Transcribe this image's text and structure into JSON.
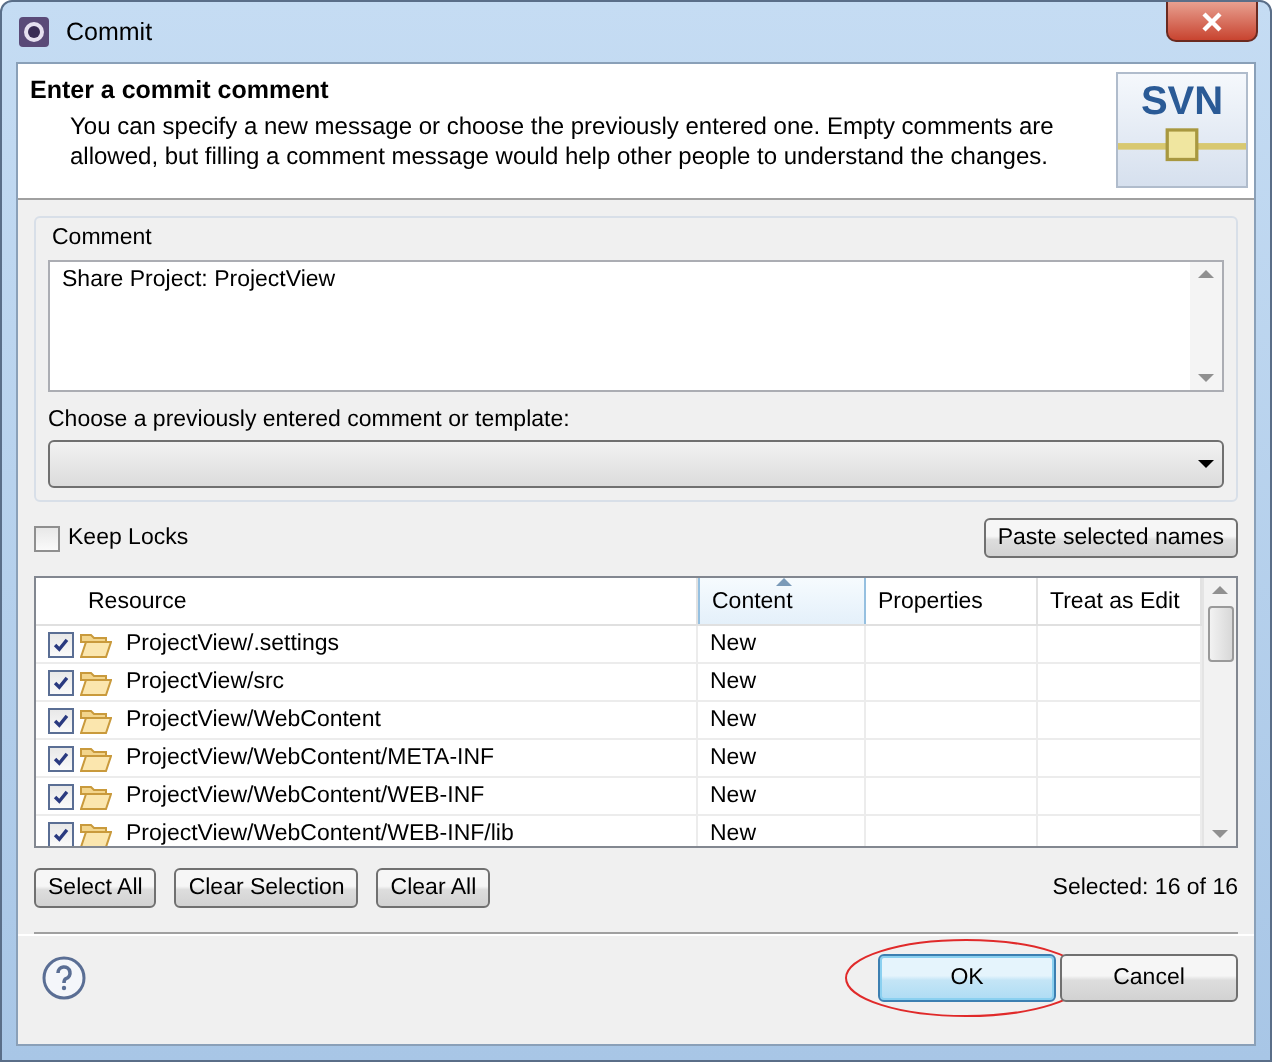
{
  "window": {
    "title": "Commit"
  },
  "header": {
    "title": "Enter a commit comment",
    "description": "You can specify a new message or choose the previously entered one. Empty comments are allowed, but filling a comment message would help other people to understand the changes.",
    "logo": "SVN"
  },
  "comment": {
    "label": "Comment",
    "value": "Share Project: ProjectView",
    "history_label": "Choose a previously entered comment or template:"
  },
  "keep_locks": {
    "label": "Keep Locks",
    "checked": false
  },
  "paste_button": "Paste selected names",
  "table": {
    "columns": [
      {
        "label": "Resource",
        "sorted": false
      },
      {
        "label": "Content",
        "sorted": true
      },
      {
        "label": "Properties",
        "sorted": false
      },
      {
        "label": "Treat as Edit",
        "sorted": false
      }
    ],
    "rows": [
      {
        "checked": true,
        "resource": "ProjectView/.settings",
        "content": "New"
      },
      {
        "checked": true,
        "resource": "ProjectView/src",
        "content": "New"
      },
      {
        "checked": true,
        "resource": "ProjectView/WebContent",
        "content": "New"
      },
      {
        "checked": true,
        "resource": "ProjectView/WebContent/META-INF",
        "content": "New"
      },
      {
        "checked": true,
        "resource": "ProjectView/WebContent/WEB-INF",
        "content": "New"
      },
      {
        "checked": true,
        "resource": "ProjectView/WebContent/WEB-INF/lib",
        "content": "New"
      }
    ]
  },
  "selection_buttons": [
    "Select All",
    "Clear Selection",
    "Clear All"
  ],
  "selected_count": "Selected: 16 of 16",
  "dialog_buttons": [
    {
      "label": "OK",
      "kind": "default",
      "circled": true
    },
    {
      "label": "Cancel",
      "kind": "normal",
      "circled": false
    }
  ]
}
